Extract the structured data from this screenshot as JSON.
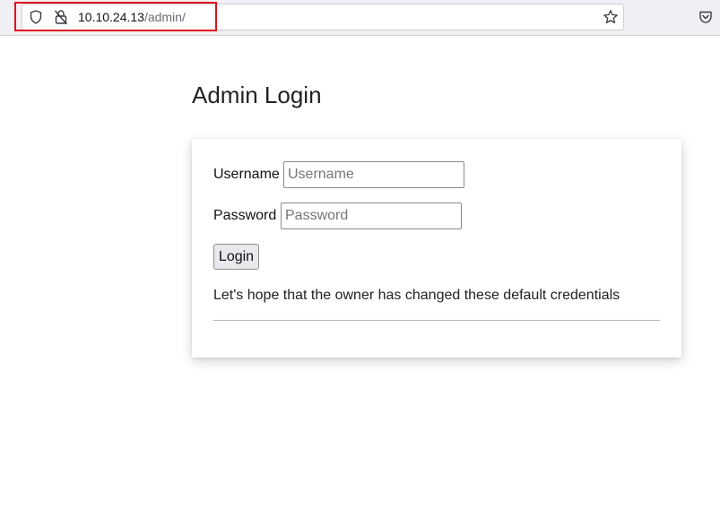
{
  "browser": {
    "url_host": "10.10.24.13",
    "url_path": "/admin/",
    "icons": {
      "shield": "shield-icon",
      "lock": "lock-icon",
      "bookmark": "star-icon",
      "pocket": "pocket-icon"
    },
    "highlight_color": "#e0101a"
  },
  "page": {
    "title": "Admin Login",
    "form": {
      "username_label": "Username",
      "username_placeholder": "Username",
      "username_value": "",
      "password_label": "Password",
      "password_placeholder": "Password",
      "password_value": "",
      "login_label": "Login"
    },
    "note": "Let's hope that the owner has changed these default credentials"
  }
}
